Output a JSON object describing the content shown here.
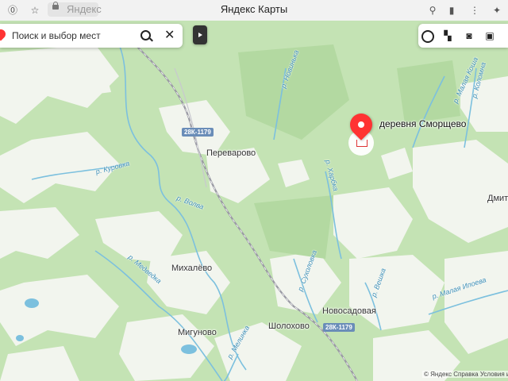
{
  "browser": {
    "domain": "Яндекс",
    "title": "Яндекс Карты",
    "icons": [
      "yandex-id-icon",
      "star-icon",
      "lock-icon",
      "location-icon",
      "bookmark-icon",
      "menu-icon"
    ]
  },
  "search": {
    "placeholder": "Поиск и выбор мест",
    "icons": [
      "yandex-pin-icon",
      "search-icon",
      "close-icon",
      "route-icon"
    ]
  },
  "layers": {
    "icons": [
      "yandex-logo-icon",
      "panorama-icon",
      "photo-camera-icon",
      "transit-icon",
      "bus-icon"
    ]
  },
  "marker": {
    "label": "деревня Сморщево"
  },
  "map": {
    "places": [
      {
        "name": "Переварово"
      },
      {
        "name": "Михалёво"
      },
      {
        "name": "Мигуново"
      },
      {
        "name": "Шолохово"
      },
      {
        "name": "Новосадовая"
      },
      {
        "name": "Дмитро"
      }
    ],
    "rivers": [
      "р. Куровка",
      "р. Волва",
      "р. Медведка",
      "р. Малая Ипоева",
      "р. Новинька",
      "р. Сухоловка",
      "р. Вешка",
      "р. Мелинка",
      "р. Малая Коша",
      "р. Коломна",
      "р. Харбка"
    ],
    "road_shields": [
      "28К-1179",
      "28К-1179"
    ]
  },
  "footer": {
    "text": "© Яндекс   Справка   Условия испол"
  },
  "colors": {
    "forest": "#bfe0b0",
    "field": "#f4f6f0",
    "water": "#7cc0de",
    "road": "#a9a9b0",
    "marker": "#ff3333",
    "shield": "#6a8db8"
  }
}
